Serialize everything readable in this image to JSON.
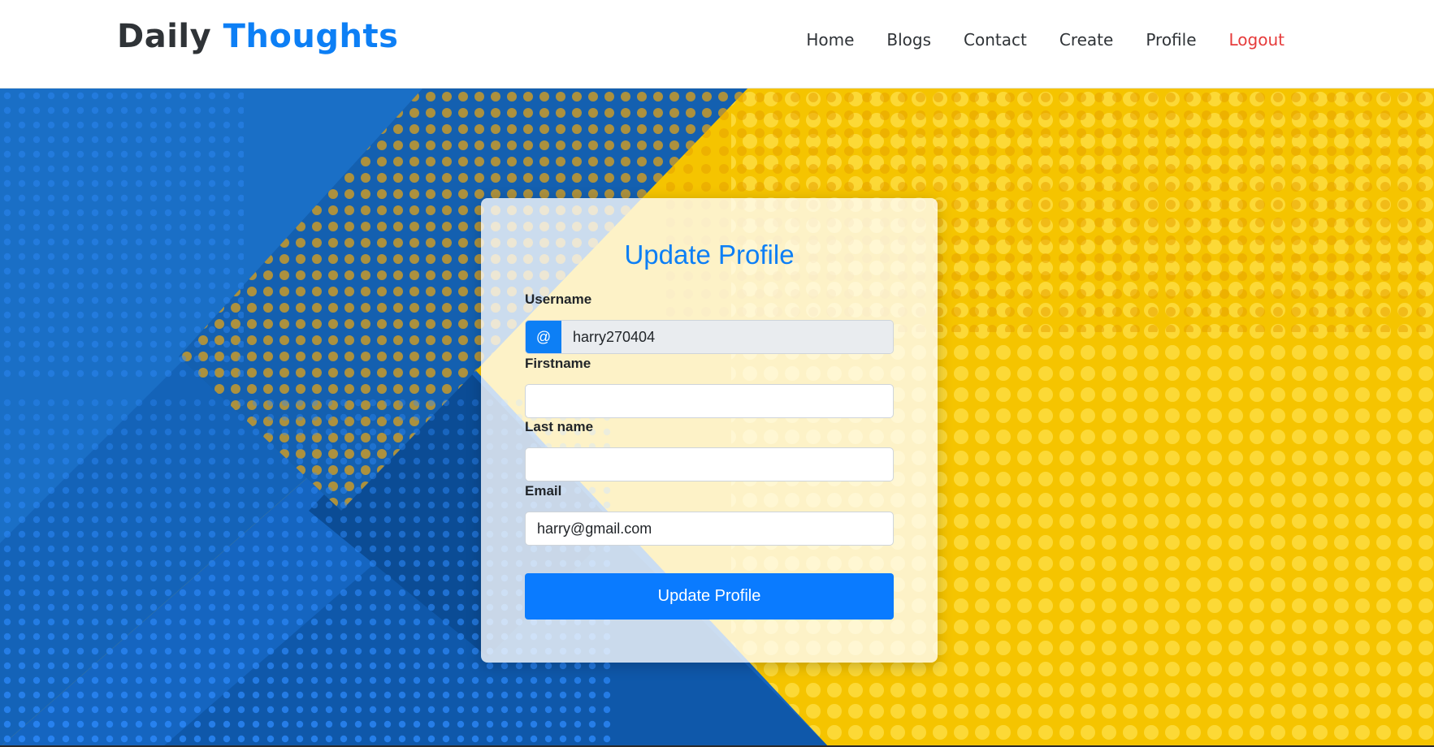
{
  "header": {
    "brand_part1": "Daily",
    "brand_part2": "Thoughts",
    "nav": {
      "home": "Home",
      "blogs": "Blogs",
      "contact": "Contact",
      "create": "Create",
      "profile": "Profile",
      "logout": "Logout"
    }
  },
  "form": {
    "title": "Update Profile",
    "username_label": "Username",
    "username_prefix": "@",
    "username_value": "harry270404",
    "firstname_label": "Firstname",
    "firstname_value": "",
    "lastname_label": "Last name",
    "lastname_value": "",
    "email_label": "Email",
    "email_value": "harry@gmail.com",
    "submit_label": "Update Profile"
  },
  "colors": {
    "brand_blue": "#0d7ff5",
    "logout_red": "#e63b3b",
    "background_blue": "#1565c0",
    "background_yellow": "#f5c800"
  }
}
